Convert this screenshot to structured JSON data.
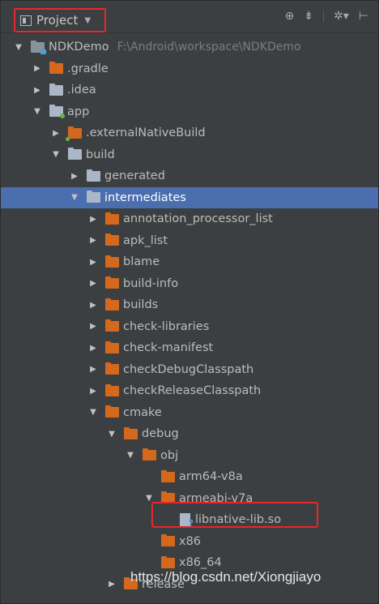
{
  "toolbar": {
    "view_label": "Project",
    "icons": [
      "target-icon",
      "collapse-icon",
      "gear-icon",
      "hide-icon"
    ]
  },
  "tree": [
    {
      "label": "NDKDemo",
      "hint": "F:\\Android\\workspace\\NDKDemo",
      "depth": 0,
      "arrow": "down",
      "icon": "module"
    },
    {
      "label": ".gradle",
      "depth": 1,
      "arrow": "right",
      "icon": "orange"
    },
    {
      "label": ".idea",
      "depth": 1,
      "arrow": "right",
      "icon": "gray"
    },
    {
      "label": "app",
      "depth": 1,
      "arrow": "down",
      "icon": "app"
    },
    {
      "label": ".externalNativeBuild",
      "depth": 2,
      "arrow": "right",
      "icon": "orange"
    },
    {
      "label": "build",
      "depth": 2,
      "arrow": "down",
      "icon": "gray"
    },
    {
      "label": "generated",
      "depth": 3,
      "arrow": "right",
      "icon": "gray"
    },
    {
      "label": "intermediates",
      "depth": 3,
      "arrow": "down",
      "icon": "gray",
      "selected": true
    },
    {
      "label": "annotation_processor_list",
      "depth": 4,
      "arrow": "right",
      "icon": "orange"
    },
    {
      "label": "apk_list",
      "depth": 4,
      "arrow": "right",
      "icon": "orange"
    },
    {
      "label": "blame",
      "depth": 4,
      "arrow": "right",
      "icon": "orange"
    },
    {
      "label": "build-info",
      "depth": 4,
      "arrow": "right",
      "icon": "orange"
    },
    {
      "label": "builds",
      "depth": 4,
      "arrow": "right",
      "icon": "orange"
    },
    {
      "label": "check-libraries",
      "depth": 4,
      "arrow": "right",
      "icon": "orange"
    },
    {
      "label": "check-manifest",
      "depth": 4,
      "arrow": "right",
      "icon": "orange"
    },
    {
      "label": "checkDebugClasspath",
      "depth": 4,
      "arrow": "right",
      "icon": "orange"
    },
    {
      "label": "checkReleaseClasspath",
      "depth": 4,
      "arrow": "right",
      "icon": "orange"
    },
    {
      "label": "cmake",
      "depth": 4,
      "arrow": "down",
      "icon": "orange"
    },
    {
      "label": "debug",
      "depth": 5,
      "arrow": "down",
      "icon": "orange"
    },
    {
      "label": "obj",
      "depth": 6,
      "arrow": "down",
      "icon": "orange"
    },
    {
      "label": "arm64-v8a",
      "depth": 7,
      "arrow": "none",
      "icon": "orange"
    },
    {
      "label": "armeabi-v7a",
      "depth": 7,
      "arrow": "down",
      "icon": "orange"
    },
    {
      "label": "libnative-lib.so",
      "depth": 8,
      "arrow": "none",
      "icon": "file"
    },
    {
      "label": "x86",
      "depth": 7,
      "arrow": "none",
      "icon": "orange"
    },
    {
      "label": "x86_64",
      "depth": 7,
      "arrow": "none",
      "icon": "orange"
    },
    {
      "label": "release",
      "depth": 5,
      "arrow": "right",
      "icon": "orange"
    }
  ],
  "watermark": "https://blog.csdn.net/Xiongjiayo"
}
